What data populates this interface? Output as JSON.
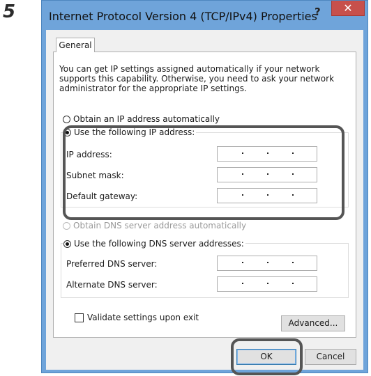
{
  "step_number": "5",
  "window": {
    "title": "Internet Protocol Version 4 (TCP/IPv4) Properties",
    "help_symbol": "?",
    "close_symbol": "✕"
  },
  "tab": {
    "label": "General"
  },
  "intro": "You can get IP settings assigned automatically if your network supports this capability. Otherwise, you need to ask your network administrator for the appropriate IP settings.",
  "ip": {
    "auto_label": "Obtain an IP address automatically",
    "manual_label": "Use the following IP address:",
    "manual_selected": true,
    "fields": [
      {
        "label": "IP address:",
        "value": ". . ."
      },
      {
        "label": "Subnet mask:",
        "value": ". . ."
      },
      {
        "label": "Default gateway:",
        "value": ". . ."
      }
    ]
  },
  "dns": {
    "auto_label": "Obtain DNS server address automatically",
    "manual_label": "Use the following DNS server addresses:",
    "manual_selected": true,
    "fields": [
      {
        "label": "Preferred DNS server:",
        "value": ". . ."
      },
      {
        "label": "Alternate DNS server:",
        "value": ". . ."
      }
    ]
  },
  "validate_label": "Validate settings upon exit",
  "validate_checked": false,
  "buttons": {
    "advanced": "Advanced...",
    "ok": "OK",
    "cancel": "Cancel"
  },
  "colors": {
    "title_bar": "#6fa4da",
    "close": "#c7504c",
    "highlight": "#555555"
  }
}
